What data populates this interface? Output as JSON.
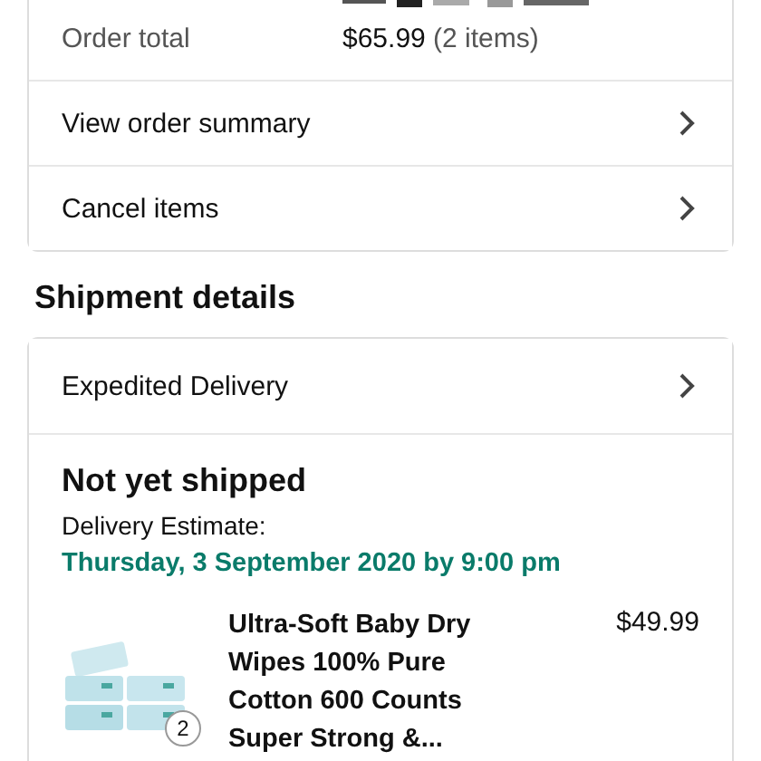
{
  "order_info": [
    {
      "kind": "redacted"
    },
    {
      "label": "Order total",
      "kind": "text",
      "value": "$65.99",
      "note": "(2 items)"
    }
  ],
  "order_links": [
    {
      "label": "View order summary"
    },
    {
      "label": "Cancel items"
    }
  ],
  "shipment": {
    "heading": "Shipment details",
    "shipping_speed": "Expedited Delivery",
    "status": "Not yet shipped",
    "estimate_label": "Delivery Estimate:",
    "estimate_date": "Thursday, 3 September 2020 by 9:00 pm",
    "items": [
      {
        "title": "Ultra-Soft Baby Dry Wipes 100% Pure Cotton 600 Counts Super Strong &...",
        "price": "$49.99",
        "quantity": "2"
      }
    ]
  }
}
